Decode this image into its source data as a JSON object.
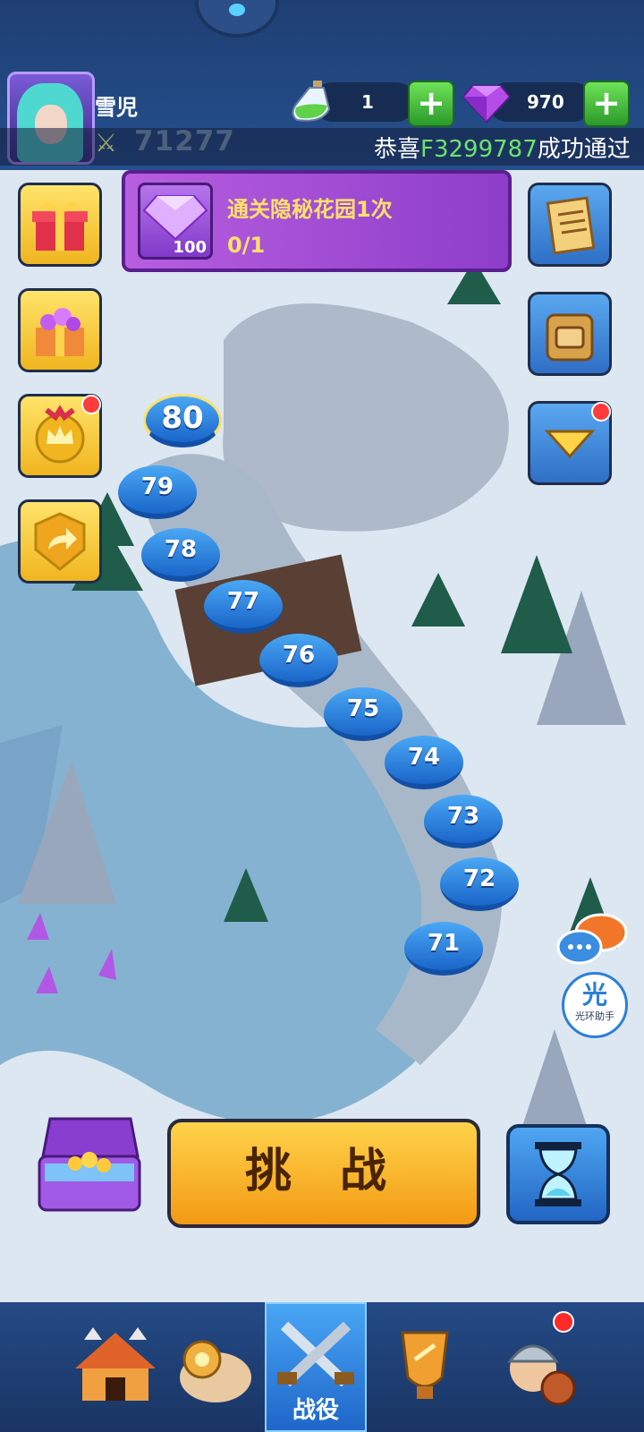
{
  "header": {
    "player_name": "雪児",
    "power_value": "71277",
    "potion_count": "1",
    "gem_count": "970",
    "ticker_prefix": "恭喜",
    "ticker_code": "F3299787",
    "ticker_suffix": "成功通过"
  },
  "quest": {
    "title": "通关隐秘花园1次",
    "progress": "0/1",
    "reward_count": "100"
  },
  "levels": [
    "80",
    "79",
    "78",
    "77",
    "76",
    "75",
    "74",
    "73",
    "72",
    "71"
  ],
  "current_level": "80",
  "actions": {
    "challenge_label": "挑 战"
  },
  "helper": {
    "glyph": "光",
    "label": "光环助手"
  },
  "nav": {
    "campaign_label": "战役"
  },
  "colors": {
    "accent_gold": "#f0b51f",
    "accent_blue": "#1a65c9",
    "quest_purple": "#8d3ec9",
    "badge_red": "#ff3b3b"
  }
}
